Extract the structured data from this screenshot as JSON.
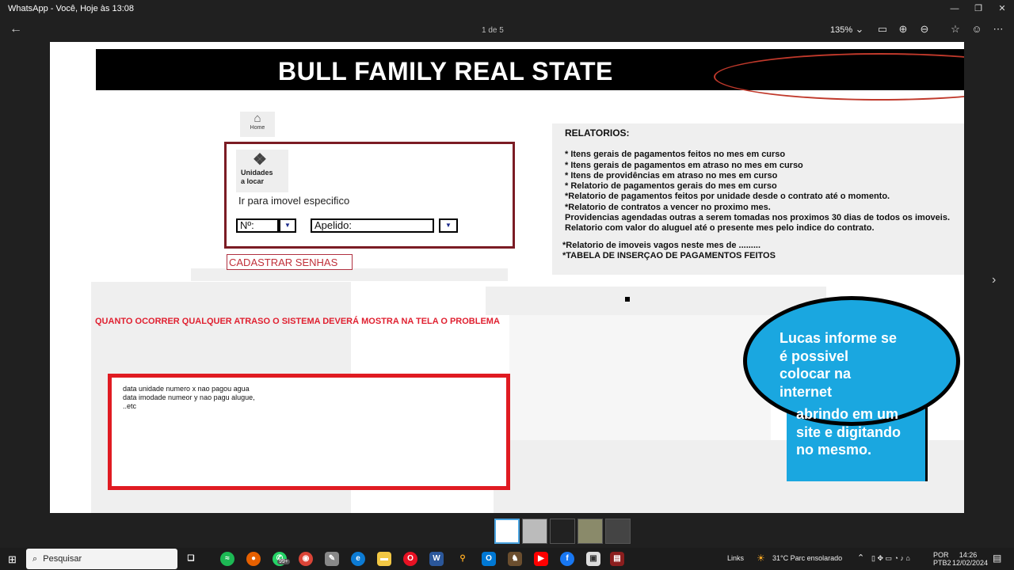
{
  "window": {
    "title": "WhatsApp - Você, Hoje às 13:08",
    "page_indicator": "1 de 5",
    "zoom": "135%"
  },
  "document": {
    "banner_title": "BULL FAMILY REAL STATE",
    "home_label": "Home",
    "unidades_label_1": "Unidades",
    "unidades_label_2": "a locar",
    "ir_para": "Ir para imovel especifico",
    "numero_field": "Nº:",
    "apelido_field": "Apelido:",
    "cadastrar_senhas": "CADASTRAR SENHAS",
    "relatorios": {
      "heading": "RELATORIOS:",
      "items": [
        "* Itens gerais de pagamentos feitos no mes em curso",
        "* Itens gerais de pagamentos em atraso  no mes em curso",
        "* Itens de providências em atraso no mes em curso",
        "* Relatorio de pagamentos gerais do mes em curso",
        "*Relatorio de pagamentos feitos por unidade desde o contrato até o momento.",
        "*Relatorio de contratos a vencer no proximo mes.",
        "Providencias agendadas  outras a serem tomadas nos proximos 30 dias de todos os imoveis.",
        "Relatorio com valor do aluguel até o presente mes pelo indice do contrato."
      ],
      "extra": [
        "*Relatorio de imoveis vagos neste mes de .........",
        "*TABELA DE INSERÇAO DE PAGAMENTOS FEITOS"
      ]
    },
    "alert_text": "QUANTO OCORRER QUALQUER ATRASO  O SISTEMA DEVERÁ MOSTRA NA TELA  O PROBLEMA",
    "error_lines": [
      "data  unidade numero x nao pagou agua",
      "data imodade numeor y nao pagu alugue,",
      "..etc"
    ],
    "bubble_lines_1": [
      "Lucas informe se",
      "é possivel",
      "colocar na",
      "internet"
    ],
    "bubble_lines_2": [
      "abrindo em um",
      "site e digitando",
      "no mesmo."
    ]
  },
  "taskbar": {
    "search_placeholder": "Pesquisar",
    "whatsapp_badge": "99+",
    "links": "Links",
    "weather": "31°C  Parc ensolarado",
    "lang_1": "POR",
    "lang_2": "PTB2",
    "time": "14:26",
    "date": "12/02/2024"
  },
  "colors": {
    "accent_red": "#e01b22",
    "dark_red": "#7b1c24",
    "bubble_blue": "#1aa7e0"
  }
}
